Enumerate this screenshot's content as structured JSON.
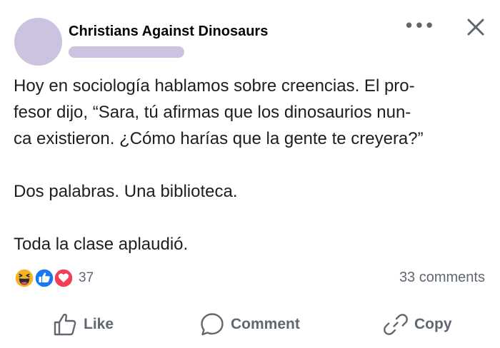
{
  "post": {
    "author": "Christians Against Dinosaurs",
    "paragraphs": [
      "Hoy en sociología hablamos sobre creencias. El pro-",
      "fesor dijo, “Sara, tú afirmas que los dinosaurios nun-",
      "ca existieron. ¿Cómo harías que la gente te creyera?”",
      "Dos palabras. Una biblioteca.",
      "Toda la clase aplaudió."
    ]
  },
  "stats": {
    "reaction_count": "37",
    "comments": "33 comments",
    "reaction_icons": [
      "haha-icon",
      "like-icon",
      "love-icon"
    ]
  },
  "actions": {
    "like": "Like",
    "comment": "Comment",
    "copy": "Copy"
  },
  "colors": {
    "placeholder": "#cbc3df",
    "like_blue": "#1877f2",
    "love_red": "#f33e58",
    "haha_yellow": "#f7b125",
    "secondary_text": "#606770"
  }
}
